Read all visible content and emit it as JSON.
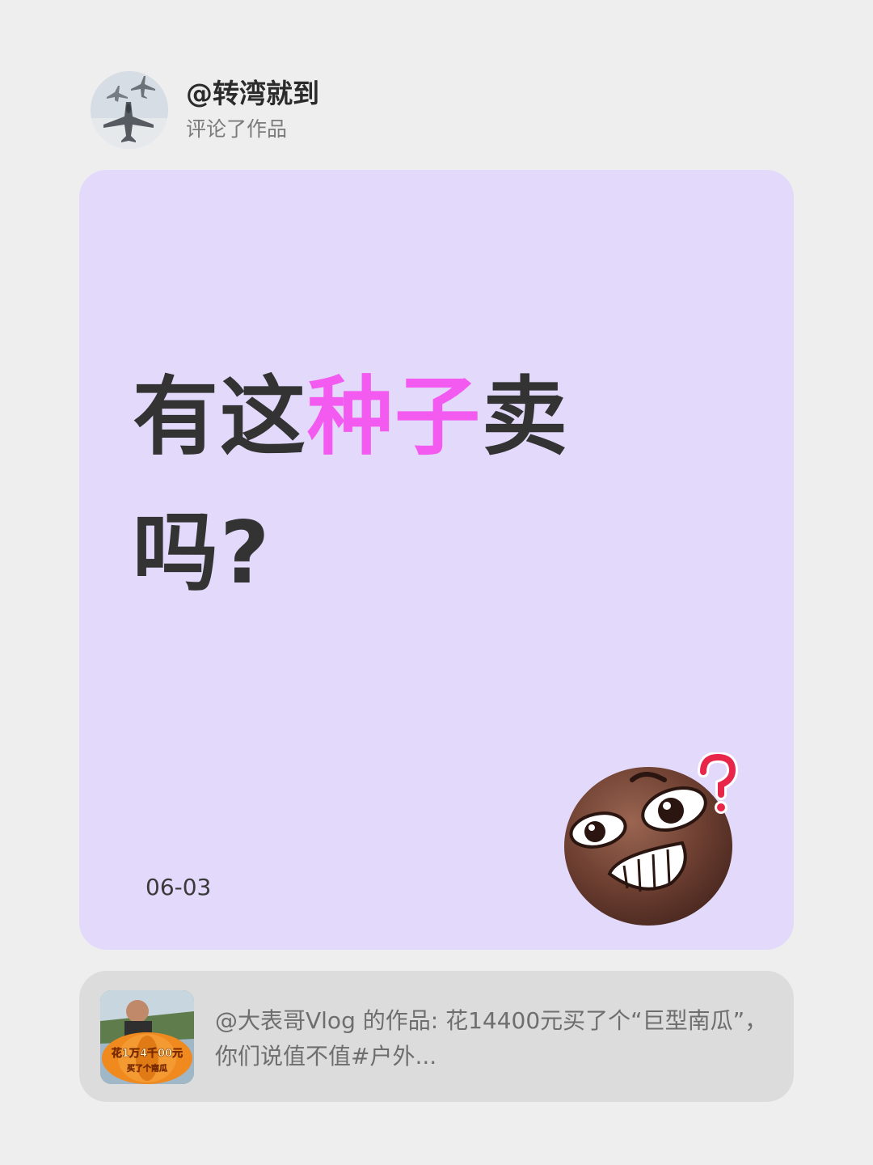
{
  "header": {
    "username": "@转湾就到",
    "action": "评论了作品"
  },
  "comment": {
    "part1": "有这",
    "highlight": "种子",
    "part2": "卖",
    "part3": "吗?",
    "date": "06-03"
  },
  "source": {
    "text": "@大表哥Vlog 的作品: 花14400元买了个“巨型南瓜”，你们说值不值#户外...",
    "thumb_caption_1": "花1万4千00元",
    "thumb_caption_2": "买了个南瓜"
  },
  "colors": {
    "card_bg": "#e3dafb",
    "highlight": "#f25af0",
    "page_bg": "#eeeeee"
  },
  "icons": {
    "avatar": "fighter-jet-avatar",
    "emoji": "confused-grin-emoji",
    "thumbnail": "pumpkin-video-thumbnail"
  }
}
